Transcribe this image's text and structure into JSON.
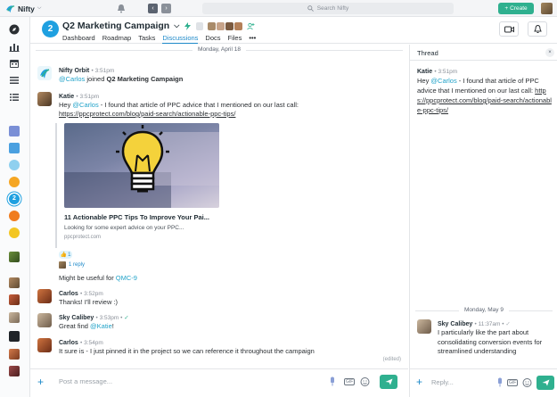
{
  "app": {
    "name": "Nifty",
    "search_placeholder": "Search Nifty",
    "create_label": "Create"
  },
  "project": {
    "badge": "2",
    "title": "Q2 Marketing Campaign",
    "tabs": [
      {
        "label": "Dashboard"
      },
      {
        "label": "Roadmap"
      },
      {
        "label": "Tasks"
      },
      {
        "label": "Discussions",
        "active": true
      },
      {
        "label": "Docs"
      },
      {
        "label": "Files"
      },
      {
        "label": "•••"
      }
    ]
  },
  "sidebar": {
    "badges": [
      "2"
    ]
  },
  "chat": {
    "date_separator": "Monday, April 18",
    "messages": [
      {
        "author": "Nifty Orbit",
        "time": "3:51pm",
        "mention": "@Carlos",
        "text_mid": " joined ",
        "bold": "Q2 Marketing Campaign"
      },
      {
        "author": "Katie",
        "time": "3:51pm",
        "prefix": "Hey ",
        "mention": "@Carlos",
        "text": " - I found that article of PPC advice that I mentioned on our last call:",
        "link": "https://ppcprotect.com/blog/paid-search/actionable-ppc-tips/"
      }
    ],
    "preview": {
      "title": "11 Actionable PPC Tips To Improve Your Pai...",
      "description": "Looking for some expert advice on your PPC...",
      "site": "ppcprotect.com"
    },
    "reaction_count": "1",
    "reply_label": "1 reply",
    "follow_up": {
      "text": "Might be useful for ",
      "tag": "QMC-9"
    },
    "later_messages": [
      {
        "author": "Carlos",
        "time": "3:52pm",
        "text": "Thanks! I'll review :)"
      },
      {
        "author": "Sky Calibey",
        "time": "3:53pm",
        "text_prefix": "Great find ",
        "mention": "@Katie",
        "text_suffix": "!"
      },
      {
        "author": "Carlos",
        "time": "3:54pm",
        "text": "It sure is - I just pinned it in the project so we can reference it throughout the campaign"
      }
    ],
    "edited_label": "(edited)",
    "composer_placeholder": "Post a message..."
  },
  "thread": {
    "title": "Thread",
    "close": "×",
    "original": {
      "author": "Katie",
      "time": "3:51pm",
      "prefix": "Hey ",
      "mention": "@Carlos",
      "text": " - I found that article of PPC advice that I mentioned on our last call:",
      "link": "https://ppcprotect.com/blog/paid-search/actionable-ppc-tips/"
    },
    "date_separator": "Monday, May 9",
    "reply": {
      "author": "Sky Calibey",
      "time": "11:37am",
      "text": "I particularly like the part about consolidating conversion events for streamlined understanding"
    },
    "composer_placeholder": "Reply..."
  },
  "icons": {
    "gif_label": "GIF"
  },
  "colors": {
    "accent": "#2fb08f",
    "link": "#22a3c9",
    "project_badge": "#1fa0e0"
  }
}
